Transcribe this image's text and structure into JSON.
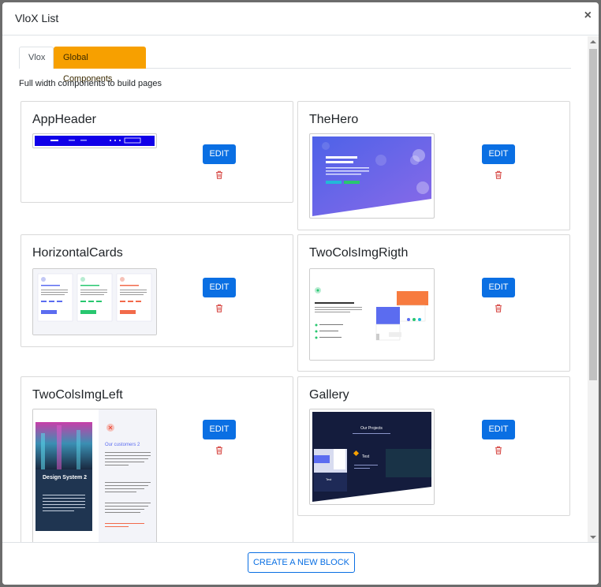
{
  "modal": {
    "title": "VloX List",
    "close_label": "×"
  },
  "tabs": [
    {
      "label": "Vlox",
      "active": false
    },
    {
      "label": "Global Components",
      "active": true
    }
  ],
  "description": "Full width components to build pages",
  "cards": [
    {
      "name": "AppHeader",
      "edit_label": "EDIT"
    },
    {
      "name": "TheHero",
      "edit_label": "EDIT"
    },
    {
      "name": "HorizontalCards",
      "edit_label": "EDIT"
    },
    {
      "name": "TwoColsImgRigth",
      "edit_label": "EDIT"
    },
    {
      "name": "TwoColsImgLeft",
      "edit_label": "EDIT"
    },
    {
      "name": "Gallery",
      "edit_label": "EDIT"
    }
  ],
  "footer": {
    "create_label": "CREATE A NEW BLOCK"
  },
  "thumbnails": {
    "hero_text": "The best platform for you web apps",
    "two_cols_right_heading": "Awesome features tool",
    "two_cols_left_title": "Design System 2",
    "two_cols_left_heading": "Our customers 2",
    "gallery_heading": "Our Projects",
    "gallery_item": "Test"
  },
  "colors": {
    "accent_orange": "#f7a000",
    "primary_blue": "#0a6fe3",
    "trash_red": "#d9534f"
  }
}
